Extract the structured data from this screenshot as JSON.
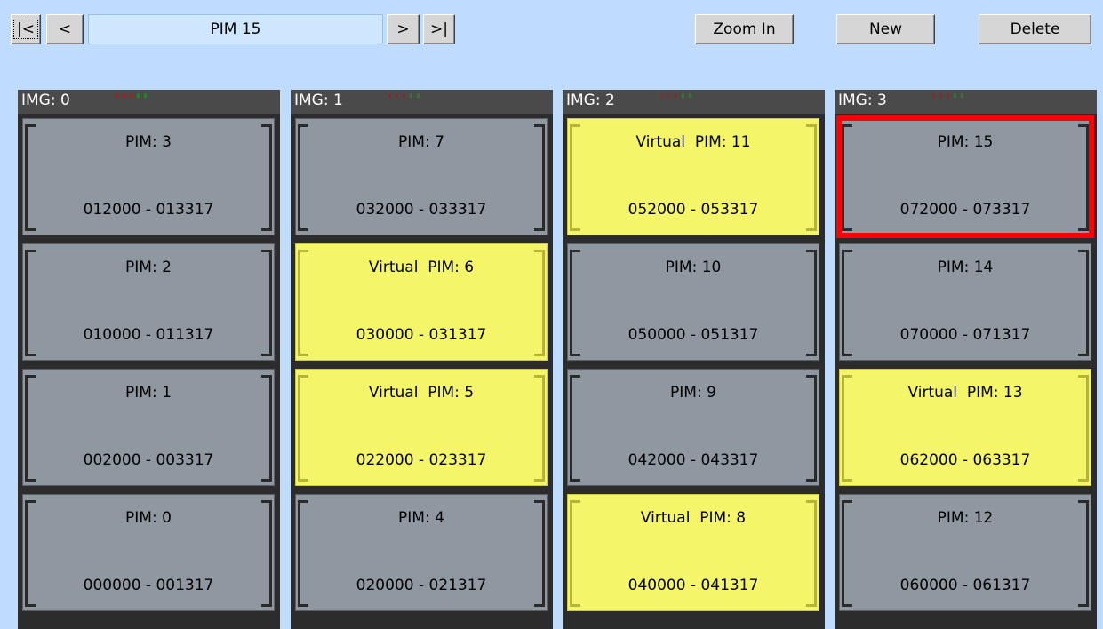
{
  "toolbar": {
    "first_label": "|<",
    "prev_label": "<",
    "current_title": "PIM 15",
    "next_label": ">",
    "last_label": ">|",
    "zoom_label": "Zoom In",
    "new_label": "New",
    "delete_label": "Delete"
  },
  "colors": {
    "background": "#bfdcff",
    "pim_physical": "#8f97a0",
    "pim_virtual": "#f5f56a",
    "selection": "#ff0000",
    "cabinet": "#2c2c2c"
  },
  "cabinets": [
    {
      "label": "IMG: 0",
      "pims": [
        {
          "title": "PIM: 3",
          "range": "012000 - 013317",
          "virtual": false,
          "selected": false
        },
        {
          "title": "PIM: 2",
          "range": "010000 - 011317",
          "virtual": false,
          "selected": false
        },
        {
          "title": "PIM: 1",
          "range": "002000 - 003317",
          "virtual": false,
          "selected": false
        },
        {
          "title": "PIM: 0",
          "range": "000000 - 001317",
          "virtual": false,
          "selected": false
        }
      ]
    },
    {
      "label": "IMG: 1",
      "pims": [
        {
          "title": "PIM: 7",
          "range": "032000 - 033317",
          "virtual": false,
          "selected": false
        },
        {
          "title": "Virtual  PIM: 6",
          "range": "030000 - 031317",
          "virtual": true,
          "selected": false
        },
        {
          "title": "Virtual  PIM: 5",
          "range": "022000 - 023317",
          "virtual": true,
          "selected": false
        },
        {
          "title": "PIM: 4",
          "range": "020000 - 021317",
          "virtual": false,
          "selected": false
        }
      ]
    },
    {
      "label": "IMG: 2",
      "pims": [
        {
          "title": "Virtual  PIM: 11",
          "range": "052000 - 053317",
          "virtual": true,
          "selected": false
        },
        {
          "title": "PIM: 10",
          "range": "050000 - 051317",
          "virtual": false,
          "selected": false
        },
        {
          "title": "PIM: 9",
          "range": "042000 - 043317",
          "virtual": false,
          "selected": false
        },
        {
          "title": "Virtual  PIM: 8",
          "range": "040000 - 041317",
          "virtual": true,
          "selected": false
        }
      ]
    },
    {
      "label": "IMG: 3",
      "pims": [
        {
          "title": "PIM: 15",
          "range": "072000 - 073317",
          "virtual": false,
          "selected": true
        },
        {
          "title": "PIM: 14",
          "range": "070000 - 071317",
          "virtual": false,
          "selected": false
        },
        {
          "title": "Virtual  PIM: 13",
          "range": "062000 - 063317",
          "virtual": true,
          "selected": false
        },
        {
          "title": "PIM: 12",
          "range": "060000 - 061317",
          "virtual": false,
          "selected": false
        }
      ]
    }
  ]
}
